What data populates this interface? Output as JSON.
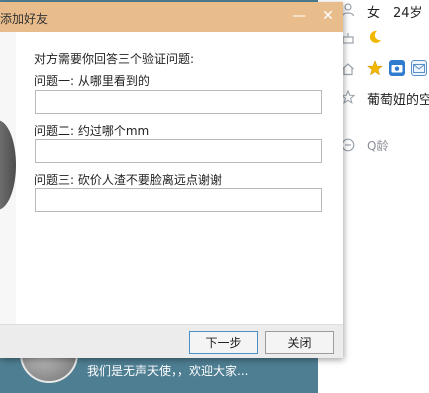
{
  "dialog": {
    "title": "添加好友",
    "prompt": "对方需要你回答三个验证问题:",
    "questions": [
      {
        "label": "问题一: 从哪里看到的",
        "value": ""
      },
      {
        "label": "问题二: 约过哪个mm",
        "value": ""
      },
      {
        "label": "问题三: 砍价人渣不要脸离远点谢谢",
        "value": ""
      }
    ],
    "next_label": "下一步",
    "close_label": "关闭",
    "minimize_glyph": "—",
    "close_glyph": "✕"
  },
  "profile": {
    "gender": "女",
    "age": "24岁",
    "bio": "我们是无声天使，，欢迎大家...",
    "space_name": "葡萄妞的空",
    "q_age": "Q龄",
    "icons": [
      "person-icon",
      "cake-icon",
      "home-icon",
      "star-outline-icon",
      "comment-icon",
      "moon-icon",
      "star-icon",
      "camera-icon",
      "mail-icon"
    ]
  },
  "colors": {
    "titlebar": "#e9bc8c",
    "banner": "#4e7e92",
    "star": "#f2b800",
    "camera": "#2f7bd0",
    "mail": "#5a8fc8"
  }
}
